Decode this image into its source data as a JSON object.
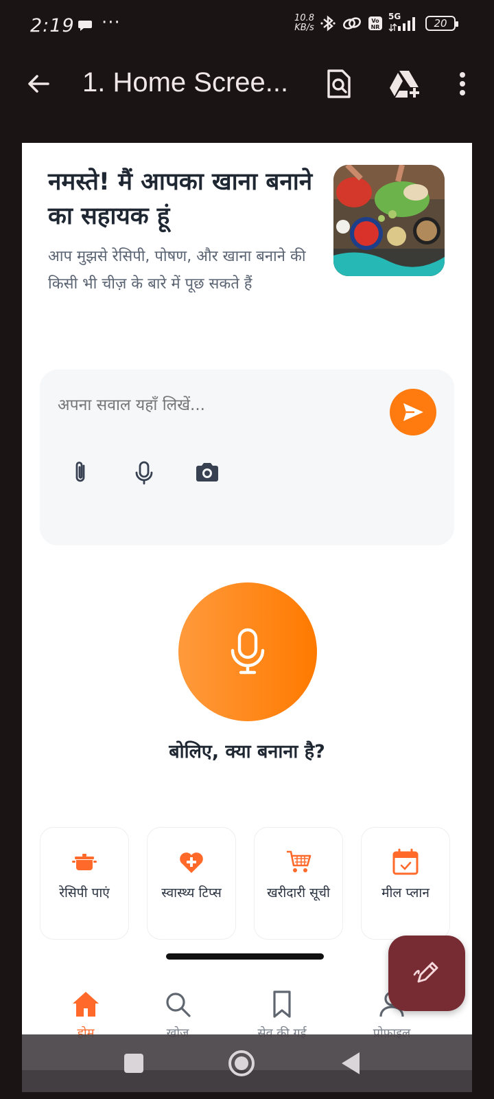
{
  "status_bar": {
    "time": "2:19",
    "more": "···",
    "net_speed_value": "10.8",
    "net_speed_unit": "KB/s",
    "network": "5G",
    "battery": "20"
  },
  "app_bar": {
    "title": "1. Home Scree..."
  },
  "hero": {
    "greeting": "नमस्ते! मैं आपका खाना बनाने का सहायक हूं",
    "subtitle": "आप मुझसे रेसिपी, पोषण, और खाना बनाने की किसी भी चीज़ के बारे में पूछ सकते हैं"
  },
  "ask": {
    "placeholder": "अपना सवाल यहाँ लिखें..."
  },
  "voice": {
    "prompt": "बोलिए, क्या बनाना है?"
  },
  "quick_actions": [
    {
      "label": "रेसिपी पाएं",
      "icon": "cooking-pot-icon"
    },
    {
      "label": "स्वास्थ्य टिप्स",
      "icon": "heart-plus-icon"
    },
    {
      "label": "खरीदारी सूची",
      "icon": "shopping-cart-icon"
    },
    {
      "label": "मील प्लान",
      "icon": "calendar-check-icon"
    }
  ],
  "bottom_nav": [
    {
      "label": "होम",
      "icon": "home-icon",
      "active": true
    },
    {
      "label": "खोज",
      "icon": "search-icon",
      "active": false
    },
    {
      "label": "सेव की गई",
      "icon": "bookmark-icon",
      "active": false
    },
    {
      "label": "प्रोफ़ाइल",
      "icon": "user-icon",
      "active": false
    }
  ],
  "colors": {
    "accent": "#ff7b0f",
    "fab": "#772c34",
    "app_bg": "#1b1414"
  }
}
